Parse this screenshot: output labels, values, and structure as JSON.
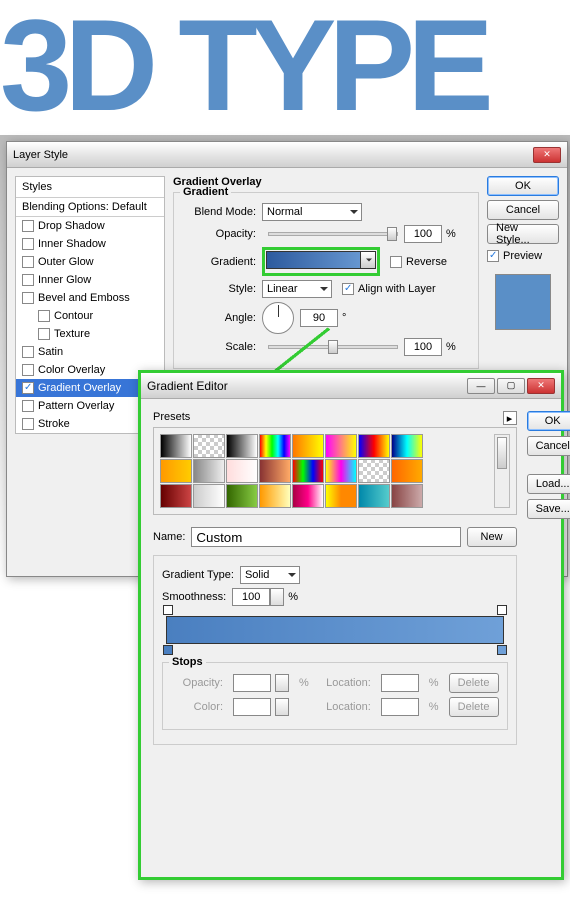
{
  "bg_text": "3D TYPE",
  "layer_style": {
    "title": "Layer Style",
    "styles_header": "Styles",
    "blending_options": "Blending Options: Default",
    "effects": [
      {
        "label": "Drop Shadow",
        "checked": false
      },
      {
        "label": "Inner Shadow",
        "checked": false
      },
      {
        "label": "Outer Glow",
        "checked": false
      },
      {
        "label": "Inner Glow",
        "checked": false
      },
      {
        "label": "Bevel and Emboss",
        "checked": false
      },
      {
        "label": "Contour",
        "checked": false,
        "sub": true
      },
      {
        "label": "Texture",
        "checked": false,
        "sub": true
      },
      {
        "label": "Satin",
        "checked": false
      },
      {
        "label": "Color Overlay",
        "checked": false
      },
      {
        "label": "Gradient Overlay",
        "checked": true,
        "selected": true
      },
      {
        "label": "Pattern Overlay",
        "checked": false
      },
      {
        "label": "Stroke",
        "checked": false
      }
    ],
    "section_title": "Gradient Overlay",
    "gradient_legend": "Gradient",
    "blend_mode_label": "Blend Mode:",
    "blend_mode_value": "Normal",
    "opacity_label": "Opacity:",
    "opacity_value": "100",
    "percent": "%",
    "gradient_label": "Gradient:",
    "reverse_label": "Reverse",
    "style_label": "Style:",
    "style_value": "Linear",
    "align_label": "Align with Layer",
    "angle_label": "Angle:",
    "angle_value": "90",
    "degree": "°",
    "scale_label": "Scale:",
    "scale_value": "100",
    "buttons": {
      "ok": "OK",
      "cancel": "Cancel",
      "new_style": "New Style...",
      "preview": "Preview"
    }
  },
  "gradient_editor": {
    "title": "Gradient Editor",
    "presets_label": "Presets",
    "name_label": "Name:",
    "name_value": "Custom",
    "new_btn": "New",
    "type_label": "Gradient Type:",
    "type_value": "Solid",
    "smoothness_label": "Smoothness:",
    "smoothness_value": "100",
    "percent": "%",
    "stops_legend": "Stops",
    "opacity_label": "Opacity:",
    "location_label": "Location:",
    "color_label": "Color:",
    "delete_label": "Delete",
    "buttons": {
      "ok": "OK",
      "cancel": "Cancel",
      "load": "Load...",
      "save": "Save..."
    },
    "preset_gradients": [
      "linear-gradient(90deg,#000,#fff)",
      "repeating-conic-gradient(#ccc 0 25%,#fff 0 50%) 0/8px 8px",
      "linear-gradient(90deg,#000,#fff)",
      "linear-gradient(90deg,#f00,#ff0,#0f0,#0ff,#00f,#f0f)",
      "linear-gradient(90deg,#f70,#ff0)",
      "linear-gradient(90deg,#f0f,#ff0)",
      "linear-gradient(90deg,#00f,#f00,#ff0)",
      "linear-gradient(90deg,#008,#0ff,#ff0)",
      "linear-gradient(90deg,#f90,#fc0)",
      "linear-gradient(90deg,#888,#eee)",
      "linear-gradient(90deg,#fdd,#fff)",
      "linear-gradient(90deg,#833,#fa6)",
      "linear-gradient(90deg,#f00,#0f0,#00f,#f00)",
      "linear-gradient(90deg,#ff0,#f0e,#0ff)",
      "repeating-conic-gradient(#ccc 0 25%,#fff 0 50%) 0/8px 8px",
      "linear-gradient(90deg,#f60,#fa0)",
      "linear-gradient(90deg,#600,#c44)",
      "linear-gradient(90deg,#ccc,#fff)",
      "linear-gradient(90deg,#360,#8c4)",
      "linear-gradient(90deg,#f90,#ffb)",
      "linear-gradient(90deg,#a04,#f08,#fff)",
      "linear-gradient(90deg,#ff0,#f80,#f80)",
      "linear-gradient(90deg,#08a,#5cc)",
      "linear-gradient(90deg,#844,#caa)"
    ]
  }
}
